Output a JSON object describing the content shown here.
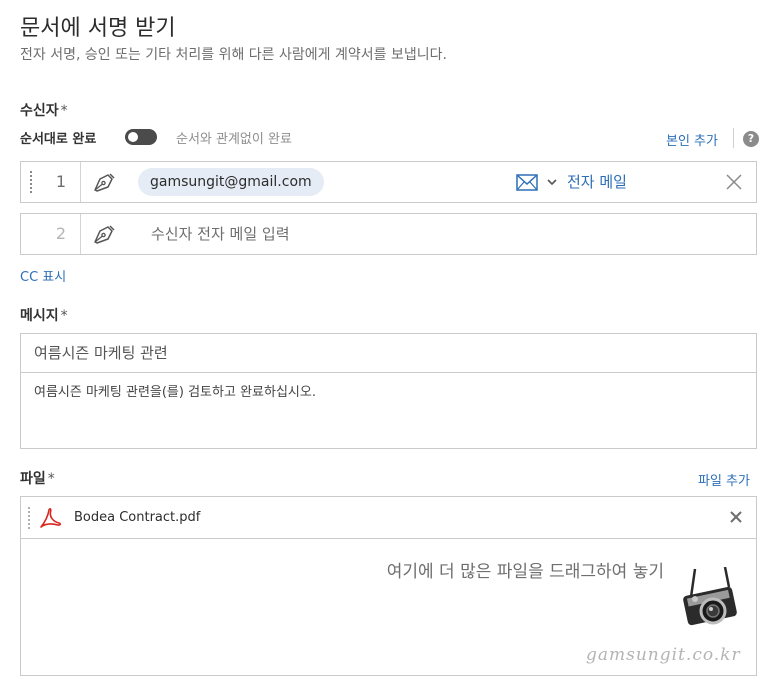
{
  "header": {
    "title": "문서에 서명 받기",
    "subtitle": "전자 서명, 승인 또는 기타 처리를 위해 다른 사람에게 계약서를 보냅니다."
  },
  "recipients": {
    "label": "수신자",
    "required_mark": "*",
    "order_toggle": {
      "label": "순서대로 완료",
      "off_label": "순서와 관계없이 완료",
      "enabled": false
    },
    "add_self": "본인 추가",
    "help_icon": "?",
    "rows": [
      {
        "number": "1",
        "role_icon": "pen-icon",
        "email": "gamsungit@gmail.com",
        "method_icon": "mail-icon",
        "method_label": "전자 메일",
        "remove_icon": "close-icon"
      },
      {
        "number": "2",
        "role_icon": "pen-icon",
        "placeholder": "수신자 전자 메일 입력"
      }
    ],
    "cc_link": "CC 표시"
  },
  "message": {
    "label": "메시지",
    "required_mark": "*",
    "subject": "여름시즌 마케팅 관련",
    "body": "여름시즌 마케팅 관련을(를) 검토하고 완료하십시오."
  },
  "files": {
    "label": "파일",
    "required_mark": "*",
    "add_file": "파일 추가",
    "items": [
      {
        "icon": "pdf-icon",
        "name": "Bodea Contract.pdf",
        "remove_icon": "close-icon"
      }
    ],
    "drop_text": "여기에 더 많은 파일을 드래그하여 놓기",
    "illustration_icon": "camera-icon"
  },
  "watermark": "gamsungit.co.kr",
  "colors": {
    "link": "#2d6fb7",
    "chip_background": "#e6ecf5",
    "border": "#cacaca",
    "pdf_red": "#d7261e"
  }
}
